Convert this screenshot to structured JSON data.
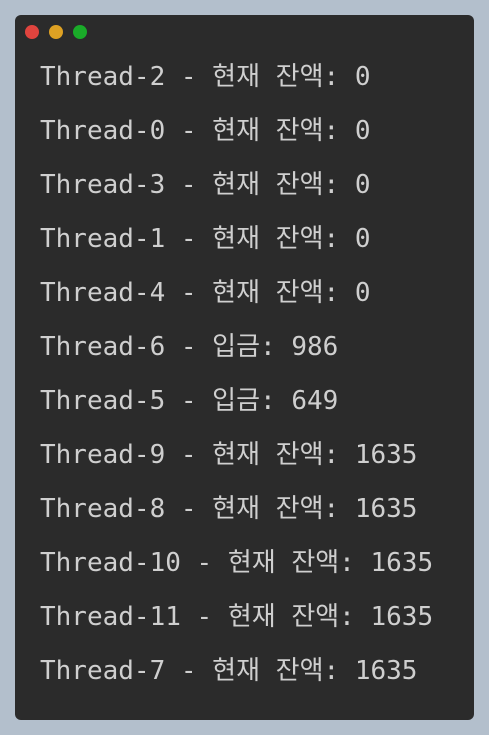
{
  "window": {
    "controls": {
      "close": "close-button",
      "minimize": "minimize-button",
      "maximize": "maximize-button"
    }
  },
  "console": {
    "lines": [
      "Thread-2 - 현재 잔액: 0",
      "Thread-0 - 현재 잔액: 0",
      "Thread-3 - 현재 잔액: 0",
      "Thread-1 - 현재 잔액: 0",
      "Thread-4 - 현재 잔액: 0",
      "Thread-6 - 입금: 986",
      "Thread-5 - 입금: 649",
      "Thread-9 - 현재 잔액: 1635",
      "Thread-8 - 현재 잔액: 1635",
      "Thread-10 - 현재 잔액: 1635",
      "Thread-11 - 현재 잔액: 1635",
      "Thread-7 - 현재 잔액: 1635"
    ]
  },
  "colors": {
    "background": "#b3bfcc",
    "window": "#2b2b2b",
    "text": "#cfcfcf",
    "close": "#e0443e",
    "minimize": "#dea123",
    "maximize": "#1aab29"
  }
}
